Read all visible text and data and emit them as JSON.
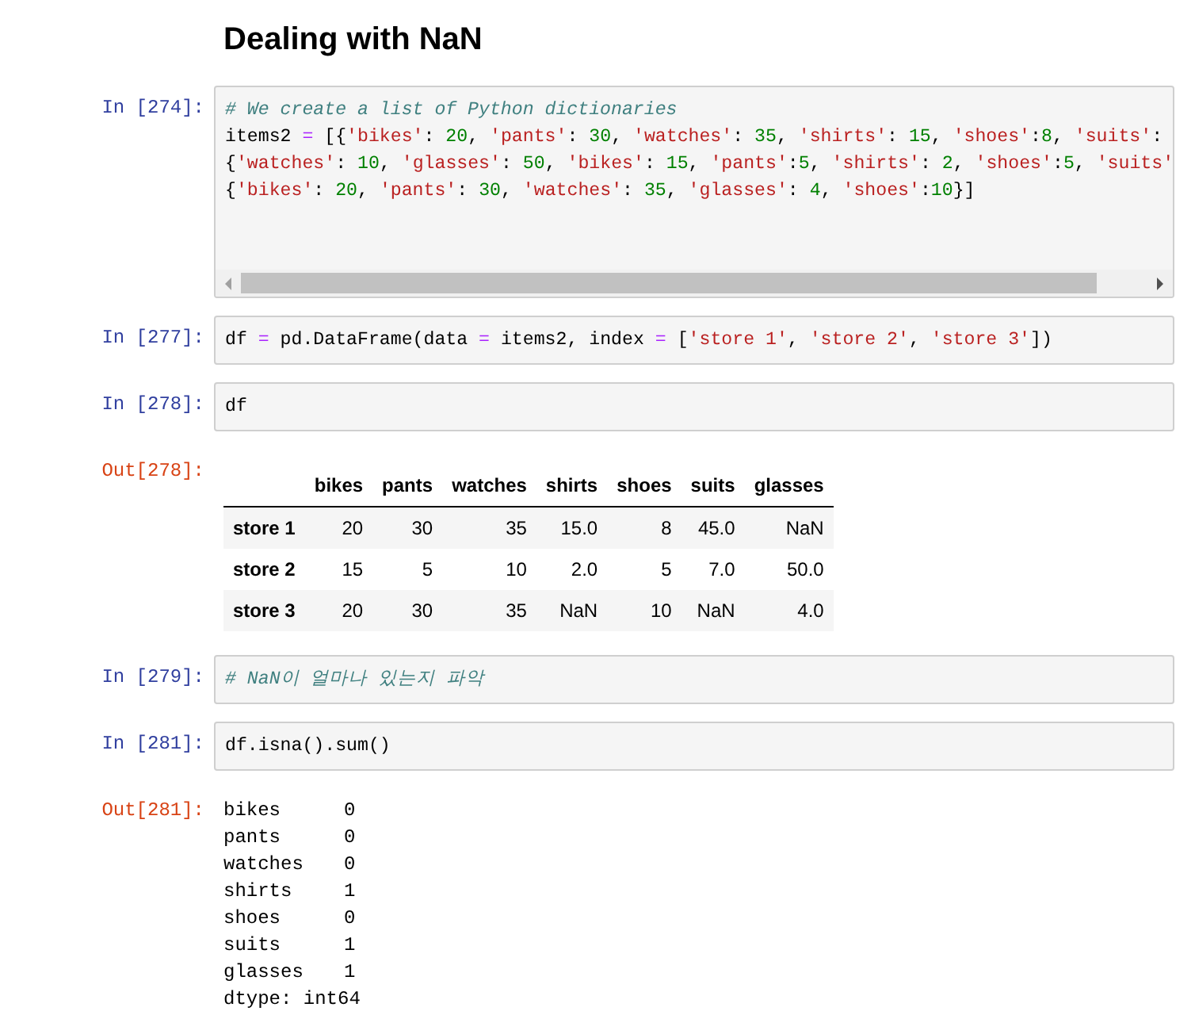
{
  "heading": "Dealing with NaN",
  "cells": [
    {
      "kind": "code",
      "prompt": "In [274]:",
      "scroll": true,
      "lines": [
        [
          {
            "kind": "comment",
            "text": "# We create a list of Python dictionaries"
          }
        ],
        [
          {
            "kind": "plain",
            "text": "items2 "
          },
          {
            "kind": "operator",
            "text": "="
          },
          {
            "kind": "plain",
            "text": " [{"
          },
          {
            "kind": "string",
            "text": "'bikes'"
          },
          {
            "kind": "plain",
            "text": ": "
          },
          {
            "kind": "number",
            "text": "20"
          },
          {
            "kind": "plain",
            "text": ", "
          },
          {
            "kind": "string",
            "text": "'pants'"
          },
          {
            "kind": "plain",
            "text": ": "
          },
          {
            "kind": "number",
            "text": "30"
          },
          {
            "kind": "plain",
            "text": ", "
          },
          {
            "kind": "string",
            "text": "'watches'"
          },
          {
            "kind": "plain",
            "text": ": "
          },
          {
            "kind": "number",
            "text": "35"
          },
          {
            "kind": "plain",
            "text": ", "
          },
          {
            "kind": "string",
            "text": "'shirts'"
          },
          {
            "kind": "plain",
            "text": ": "
          },
          {
            "kind": "number",
            "text": "15"
          },
          {
            "kind": "plain",
            "text": ", "
          },
          {
            "kind": "string",
            "text": "'shoes'"
          },
          {
            "kind": "plain",
            "text": ":"
          },
          {
            "kind": "number",
            "text": "8"
          },
          {
            "kind": "plain",
            "text": ", "
          },
          {
            "kind": "string",
            "text": "'suits'"
          },
          {
            "kind": "plain",
            "text": ":"
          }
        ],
        [
          {
            "kind": "plain",
            "text": "{"
          },
          {
            "kind": "string",
            "text": "'watches'"
          },
          {
            "kind": "plain",
            "text": ": "
          },
          {
            "kind": "number",
            "text": "10"
          },
          {
            "kind": "plain",
            "text": ", "
          },
          {
            "kind": "string",
            "text": "'glasses'"
          },
          {
            "kind": "plain",
            "text": ": "
          },
          {
            "kind": "number",
            "text": "50"
          },
          {
            "kind": "plain",
            "text": ", "
          },
          {
            "kind": "string",
            "text": "'bikes'"
          },
          {
            "kind": "plain",
            "text": ": "
          },
          {
            "kind": "number",
            "text": "15"
          },
          {
            "kind": "plain",
            "text": ", "
          },
          {
            "kind": "string",
            "text": "'pants'"
          },
          {
            "kind": "plain",
            "text": ":"
          },
          {
            "kind": "number",
            "text": "5"
          },
          {
            "kind": "plain",
            "text": ", "
          },
          {
            "kind": "string",
            "text": "'shirts'"
          },
          {
            "kind": "plain",
            "text": ": "
          },
          {
            "kind": "number",
            "text": "2"
          },
          {
            "kind": "plain",
            "text": ", "
          },
          {
            "kind": "string",
            "text": "'shoes'"
          },
          {
            "kind": "plain",
            "text": ":"
          },
          {
            "kind": "number",
            "text": "5"
          },
          {
            "kind": "plain",
            "text": ", "
          },
          {
            "kind": "string",
            "text": "'suits'"
          }
        ],
        [
          {
            "kind": "plain",
            "text": "{"
          },
          {
            "kind": "string",
            "text": "'bikes'"
          },
          {
            "kind": "plain",
            "text": ": "
          },
          {
            "kind": "number",
            "text": "20"
          },
          {
            "kind": "plain",
            "text": ", "
          },
          {
            "kind": "string",
            "text": "'pants'"
          },
          {
            "kind": "plain",
            "text": ": "
          },
          {
            "kind": "number",
            "text": "30"
          },
          {
            "kind": "plain",
            "text": ", "
          },
          {
            "kind": "string",
            "text": "'watches'"
          },
          {
            "kind": "plain",
            "text": ": "
          },
          {
            "kind": "number",
            "text": "35"
          },
          {
            "kind": "plain",
            "text": ", "
          },
          {
            "kind": "string",
            "text": "'glasses'"
          },
          {
            "kind": "plain",
            "text": ": "
          },
          {
            "kind": "number",
            "text": "4"
          },
          {
            "kind": "plain",
            "text": ", "
          },
          {
            "kind": "string",
            "text": "'shoes'"
          },
          {
            "kind": "plain",
            "text": ":"
          },
          {
            "kind": "number",
            "text": "10"
          },
          {
            "kind": "plain",
            "text": "}]"
          }
        ]
      ]
    },
    {
      "kind": "code",
      "prompt": "In [277]:",
      "scroll": false,
      "lines": [
        [
          {
            "kind": "plain",
            "text": "df "
          },
          {
            "kind": "operator",
            "text": "="
          },
          {
            "kind": "plain",
            "text": " pd.DataFrame(data "
          },
          {
            "kind": "operator",
            "text": "="
          },
          {
            "kind": "plain",
            "text": " items2, index "
          },
          {
            "kind": "operator",
            "text": "="
          },
          {
            "kind": "plain",
            "text": " ["
          },
          {
            "kind": "string",
            "text": "'store 1'"
          },
          {
            "kind": "plain",
            "text": ", "
          },
          {
            "kind": "string",
            "text": "'store 2'"
          },
          {
            "kind": "plain",
            "text": ", "
          },
          {
            "kind": "string",
            "text": "'store 3'"
          },
          {
            "kind": "plain",
            "text": "])"
          }
        ]
      ]
    },
    {
      "kind": "code",
      "prompt": "In [278]:",
      "scroll": false,
      "lines": [
        [
          {
            "kind": "plain",
            "text": "df"
          }
        ]
      ]
    },
    {
      "kind": "table",
      "prompt": "Out[278]:",
      "columns": [
        "bikes",
        "pants",
        "watches",
        "shirts",
        "shoes",
        "suits",
        "glasses"
      ],
      "rows": [
        {
          "index": "store 1",
          "cells": [
            "20",
            "30",
            "35",
            "15.0",
            "8",
            "45.0",
            "NaN"
          ]
        },
        {
          "index": "store 2",
          "cells": [
            "15",
            "5",
            "10",
            "2.0",
            "5",
            "7.0",
            "50.0"
          ]
        },
        {
          "index": "store 3",
          "cells": [
            "20",
            "30",
            "35",
            "NaN",
            "10",
            "NaN",
            "4.0"
          ]
        }
      ]
    },
    {
      "kind": "code",
      "prompt": "In [279]:",
      "scroll": false,
      "lines": [
        [
          {
            "kind": "comment",
            "text": "# NaN이 얼마나 있는지 파악"
          }
        ]
      ]
    },
    {
      "kind": "code",
      "prompt": "In [281]:",
      "scroll": false,
      "lines": [
        [
          {
            "kind": "plain",
            "text": "df.isna().sum()"
          }
        ]
      ]
    },
    {
      "kind": "series",
      "prompt": "Out[281]:",
      "items": [
        {
          "label": "bikes",
          "value": "0"
        },
        {
          "label": "pants",
          "value": "0"
        },
        {
          "label": "watches",
          "value": "0"
        },
        {
          "label": "shirts",
          "value": "1"
        },
        {
          "label": "shoes",
          "value": "0"
        },
        {
          "label": "suits",
          "value": "1"
        },
        {
          "label": "glasses",
          "value": "1"
        }
      ],
      "dtype": "dtype: int64"
    }
  ]
}
